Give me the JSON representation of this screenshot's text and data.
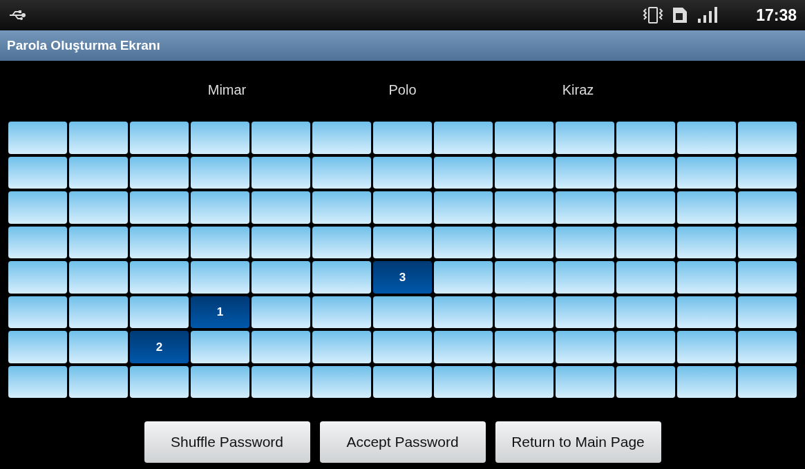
{
  "status_bar": {
    "time": "17:38"
  },
  "title_bar": {
    "title": "Parola Oluşturma Ekranı"
  },
  "image_labels": [
    "Mimar",
    "Polo",
    "Kiraz"
  ],
  "grid": {
    "rows": [
      [
        {
          "selected": false
        },
        {
          "selected": false
        },
        {
          "selected": false
        },
        {
          "selected": false
        },
        {
          "selected": false
        },
        {
          "selected": false
        },
        {
          "selected": false
        },
        {
          "selected": false
        },
        {
          "selected": false
        },
        {
          "selected": false
        },
        {
          "selected": false
        },
        {
          "selected": false
        },
        {
          "selected": false
        }
      ],
      [
        {
          "selected": false
        },
        {
          "selected": false
        },
        {
          "selected": false
        },
        {
          "selected": false
        },
        {
          "selected": false
        },
        {
          "selected": false
        },
        {
          "selected": false
        },
        {
          "selected": false
        },
        {
          "selected": false
        },
        {
          "selected": false
        },
        {
          "selected": false
        },
        {
          "selected": false
        },
        {
          "selected": false
        }
      ],
      [
        {
          "selected": false
        },
        {
          "selected": false
        },
        {
          "selected": false
        },
        {
          "selected": false
        },
        {
          "selected": false
        },
        {
          "selected": false
        },
        {
          "selected": false
        },
        {
          "selected": false
        },
        {
          "selected": false
        },
        {
          "selected": false
        },
        {
          "selected": false
        },
        {
          "selected": false
        },
        {
          "selected": false
        }
      ],
      [
        {
          "selected": false
        },
        {
          "selected": false
        },
        {
          "selected": false
        },
        {
          "selected": false
        },
        {
          "selected": false
        },
        {
          "selected": false
        },
        {
          "selected": false
        },
        {
          "selected": false
        },
        {
          "selected": false
        },
        {
          "selected": false
        },
        {
          "selected": false
        },
        {
          "selected": false
        },
        {
          "selected": false
        }
      ],
      [
        {
          "selected": false
        },
        {
          "selected": false
        },
        {
          "selected": false
        },
        {
          "selected": false
        },
        {
          "selected": false
        },
        {
          "selected": false
        },
        {
          "selected": true,
          "label": "3"
        },
        {
          "selected": false
        },
        {
          "selected": false
        },
        {
          "selected": false
        },
        {
          "selected": false
        },
        {
          "selected": false
        },
        {
          "selected": false
        }
      ],
      [
        {
          "selected": false
        },
        {
          "selected": false
        },
        {
          "selected": false
        },
        {
          "selected": true,
          "label": "1"
        },
        {
          "selected": false
        },
        {
          "selected": false
        },
        {
          "selected": false
        },
        {
          "selected": false
        },
        {
          "selected": false
        },
        {
          "selected": false
        },
        {
          "selected": false
        },
        {
          "selected": false
        },
        {
          "selected": false
        }
      ],
      [
        {
          "selected": false
        },
        {
          "selected": false
        },
        {
          "selected": true,
          "label": "2"
        },
        {
          "selected": false
        },
        {
          "selected": false
        },
        {
          "selected": false
        },
        {
          "selected": false
        },
        {
          "selected": false
        },
        {
          "selected": false
        },
        {
          "selected": false
        },
        {
          "selected": false
        },
        {
          "selected": false
        },
        {
          "selected": false
        }
      ],
      [
        {
          "selected": false
        },
        {
          "selected": false
        },
        {
          "selected": false
        },
        {
          "selected": false
        },
        {
          "selected": false
        },
        {
          "selected": false
        },
        {
          "selected": false
        },
        {
          "selected": false
        },
        {
          "selected": false
        },
        {
          "selected": false
        },
        {
          "selected": false
        },
        {
          "selected": false
        },
        {
          "selected": false
        }
      ]
    ]
  },
  "buttons": [
    "Shuffle Password",
    "Accept Password",
    "Return to Main Page"
  ]
}
